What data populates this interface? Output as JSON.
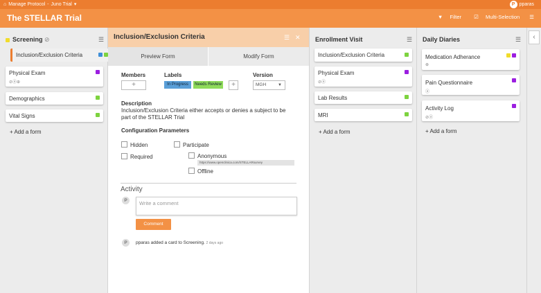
{
  "topbar": {
    "home": "Manage Protocol",
    "sep": "-",
    "study": "Juno Trial",
    "caret": "▾",
    "user_initial": "P",
    "user_name": "pparas"
  },
  "header": {
    "title": "The STELLAR Trial",
    "filter_label": "Filter",
    "multi_label": "Multi-Selection"
  },
  "columns": {
    "screening": {
      "title": "Screening",
      "cards": [
        {
          "label": "Inclusion/Exclusion Criteria"
        },
        {
          "label": "Physical Exam"
        },
        {
          "label": "Demographics"
        },
        {
          "label": "Vital Signs"
        }
      ],
      "add": "+ Add a form"
    },
    "enrollment": {
      "title": "Enrollment Visit",
      "cards": [
        {
          "label": "Inclusion/Exclusion Criteria"
        },
        {
          "label": "Physical Exam"
        },
        {
          "label": "Lab Results"
        },
        {
          "label": "MRI"
        }
      ],
      "add": "+ Add a form"
    },
    "diaries": {
      "title": "Daily Diaries",
      "cards": [
        {
          "label": "Medication Adherance"
        },
        {
          "label": "Pain Questionnaire"
        },
        {
          "label": "Activity Log"
        }
      ],
      "add": "+ Add a form"
    }
  },
  "detail": {
    "title": "Inclusion/Exclusion Criteria",
    "tab_preview": "Preview Form",
    "tab_modify": "Modify Form",
    "members_label": "Members",
    "labels_label": "Labels",
    "label_in_progress": "In Progress",
    "label_needs_review": "Needs Review",
    "version_label": "Version",
    "version_value": "MGH",
    "description_label": "Description",
    "description_line1": "Inclusion/Exclusion Criteria either accepts or denies a subject to be",
    "description_line2": "part of the STELLAR Trial",
    "config_label": "Configuration Parameters",
    "hidden": "Hidden",
    "required": "Required",
    "participate": "Participate",
    "anonymous": "Anonymous",
    "url": "https://www.openclinica.com/STELLARsurvey",
    "offline": "Offline",
    "activity_label": "Activity",
    "comment_placeholder": "Write a comment",
    "comment_button": "Comment",
    "activity_text": "pparas added a card to Screening.",
    "activity_time": "2 days ago",
    "avatar_initial": "P"
  },
  "colors": {
    "topbar": "#ec7d2f",
    "header": "#f39145",
    "blue_tag": "#3f8fd8",
    "green_tag": "#7dd33f",
    "purple_tag": "#9b1ee0",
    "yellow_tag": "#f1dc2b",
    "in_progress": "#5a9fd8",
    "needs_review": "#8fdb5a"
  }
}
